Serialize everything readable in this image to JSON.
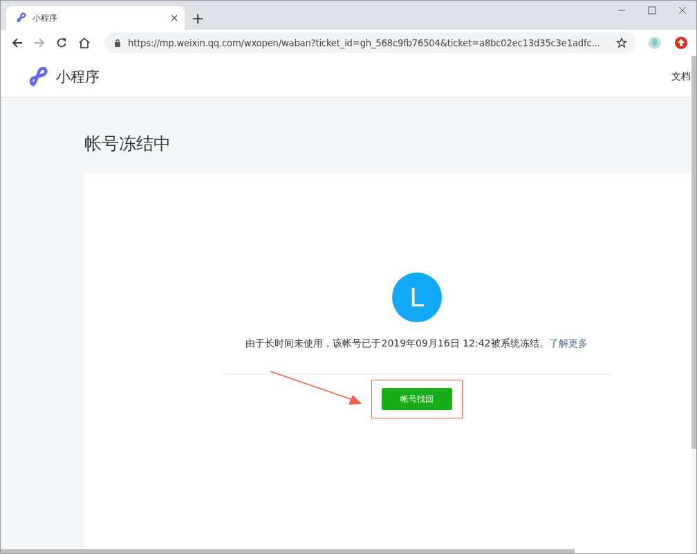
{
  "browser": {
    "tabs": [
      {
        "title": "小程序",
        "selected": true
      }
    ],
    "new_tab": "+",
    "url": "https://mp.weixin.qq.com/wxopen/waban?ticket_id=gh_568c9fb76504&ticket=a8bc02ec13d35c3e1adfc..."
  },
  "header": {
    "brand": "小程序",
    "nav_link": "文档"
  },
  "page": {
    "title": "帐号冻结中",
    "avatar_letter": "L",
    "message": "由于长时间未使用，该帐号已于2019年09月16日 12:42被系统冻结。",
    "learn_more": "了解更多",
    "recover_button": "帐号找回"
  }
}
